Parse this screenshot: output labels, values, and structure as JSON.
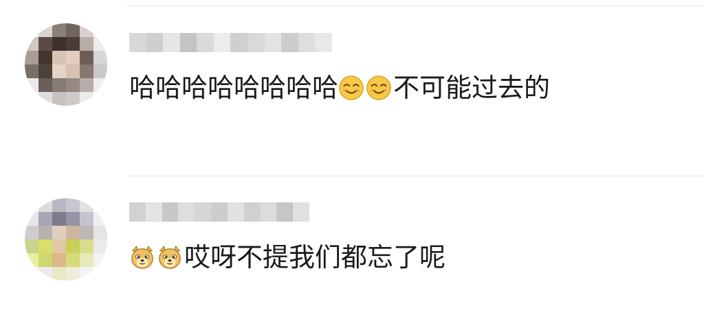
{
  "comments": [
    {
      "text_before": "哈哈哈哈哈哈哈哈",
      "emojis": [
        "smiling-emoji",
        "smiling-emoji"
      ],
      "text_after": "不可能过去的",
      "avatar_colors": [
        "#f1f1f1",
        "#d9d4d0",
        "#8b8078",
        "#6f6660",
        "#d8d0cc",
        "#f4f4f4",
        "#d0c8c2",
        "#5a4c45",
        "#3e302a",
        "#4a3c35",
        "#b9aca5",
        "#ececec",
        "#a89d98",
        "#43362f",
        "#d8c3b5",
        "#e2cec1",
        "#6c5e57",
        "#d6d6d6",
        "#7a6e68",
        "#4d413b",
        "#e6d4c8",
        "#d7c1b3",
        "#847871",
        "#c9c9c9",
        "#eaeaea",
        "#6a5e58",
        "#857a74",
        "#948983",
        "#b5ada9",
        "#efefef",
        "#f5f5f5",
        "#dedede",
        "#c7c2bf",
        "#cfcac7",
        "#ececec",
        "#fafafa"
      ],
      "username_colors": [
        "#d8d8d8",
        "#cfcfcf",
        "#e6e6e6",
        "#c4c4c4",
        "#dadada",
        "#ececec",
        "#cfcfcf",
        "#d9d9d9",
        "#e3e3e3",
        "#cccccc",
        "#dedede",
        "#e8e8e8"
      ]
    },
    {
      "text_before": "",
      "emojis": [
        "doge-emoji",
        "doge-emoji"
      ],
      "text_after": "哎呀不提我们都忘了呢",
      "avatar_colors": [
        "#f4f4f4",
        "#dcdcdc",
        "#b9b7c2",
        "#c9c6d0",
        "#e2e2e2",
        "#f7f7f7",
        "#e7e7e7",
        "#a8a5b4",
        "#7f7b8f",
        "#9893a5",
        "#c5c3cc",
        "#efefef",
        "#cfcccf",
        "#b7b1b0",
        "#e0cfbe",
        "#cdb59e",
        "#bdb7b5",
        "#e4e4e4",
        "#c9d48a",
        "#d7df6a",
        "#e2c9a5",
        "#c9d058",
        "#d8dc8c",
        "#eaeaea",
        "#e8eda2",
        "#cfd86e",
        "#dcb889",
        "#d6db78",
        "#e6e9b8",
        "#f2f2f2",
        "#f7f7f7",
        "#ececec",
        "#e7e9c7",
        "#eceed6",
        "#f3f3f3",
        "#fbfbfb"
      ],
      "username_colors": [
        "#d2d2d2",
        "#e4e4e4",
        "#c8c8c8",
        "#dedede",
        "#d6d6d6",
        "#cdcdcd",
        "#e2e2e2",
        "#d0d0d0",
        "#dcdcdc",
        "#c6c6c6",
        "#e0e0e0"
      ]
    }
  ]
}
